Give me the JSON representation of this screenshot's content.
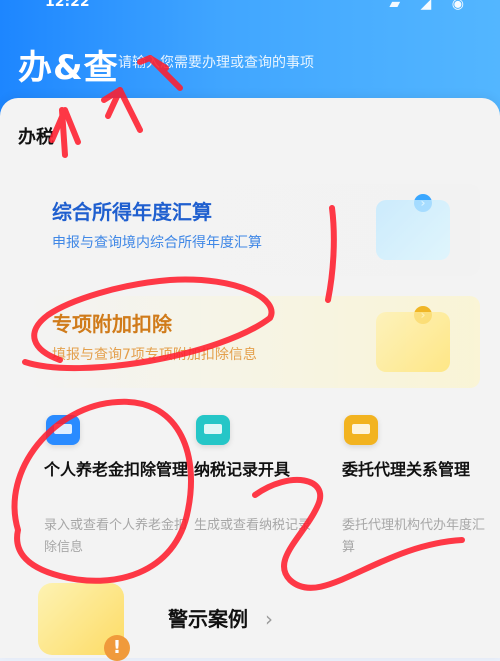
{
  "status": {
    "time": "12:22",
    "icons": "▰ ◢ ◉"
  },
  "header": {
    "title": "办&查",
    "search_hint": "请输入您需要办理或查询的事项"
  },
  "section": {
    "title": "办税"
  },
  "features": [
    {
      "title": "综合所得年度汇算",
      "desc": "申报与查询境内综合所得年度汇算",
      "arrow_icon": "chevron-right-icon"
    },
    {
      "title": "专项附加扣除",
      "desc": "填报与查询7项专项附加扣除信息",
      "arrow_icon": "chevron-right-icon"
    }
  ],
  "tiles": [
    {
      "name": "个人养老金扣除管理",
      "sub": "录入或查看个人养老金扣除信息",
      "icon": "card-icon"
    },
    {
      "name": "纳税记录开具",
      "sub": "生成或查看纳税记录",
      "icon": "receipt-icon"
    },
    {
      "name": "委托代理关系管理",
      "sub": "委托代理机构代办年度汇算",
      "icon": "handshake-icon"
    }
  ],
  "warning": {
    "label": "警示案例",
    "chevron": "›"
  },
  "colors": {
    "header_blue": "#1d86ff",
    "annotation_red": "#ff1e2e",
    "feature1_title": "#1f5fcf",
    "feature2_title": "#d07b1a"
  }
}
